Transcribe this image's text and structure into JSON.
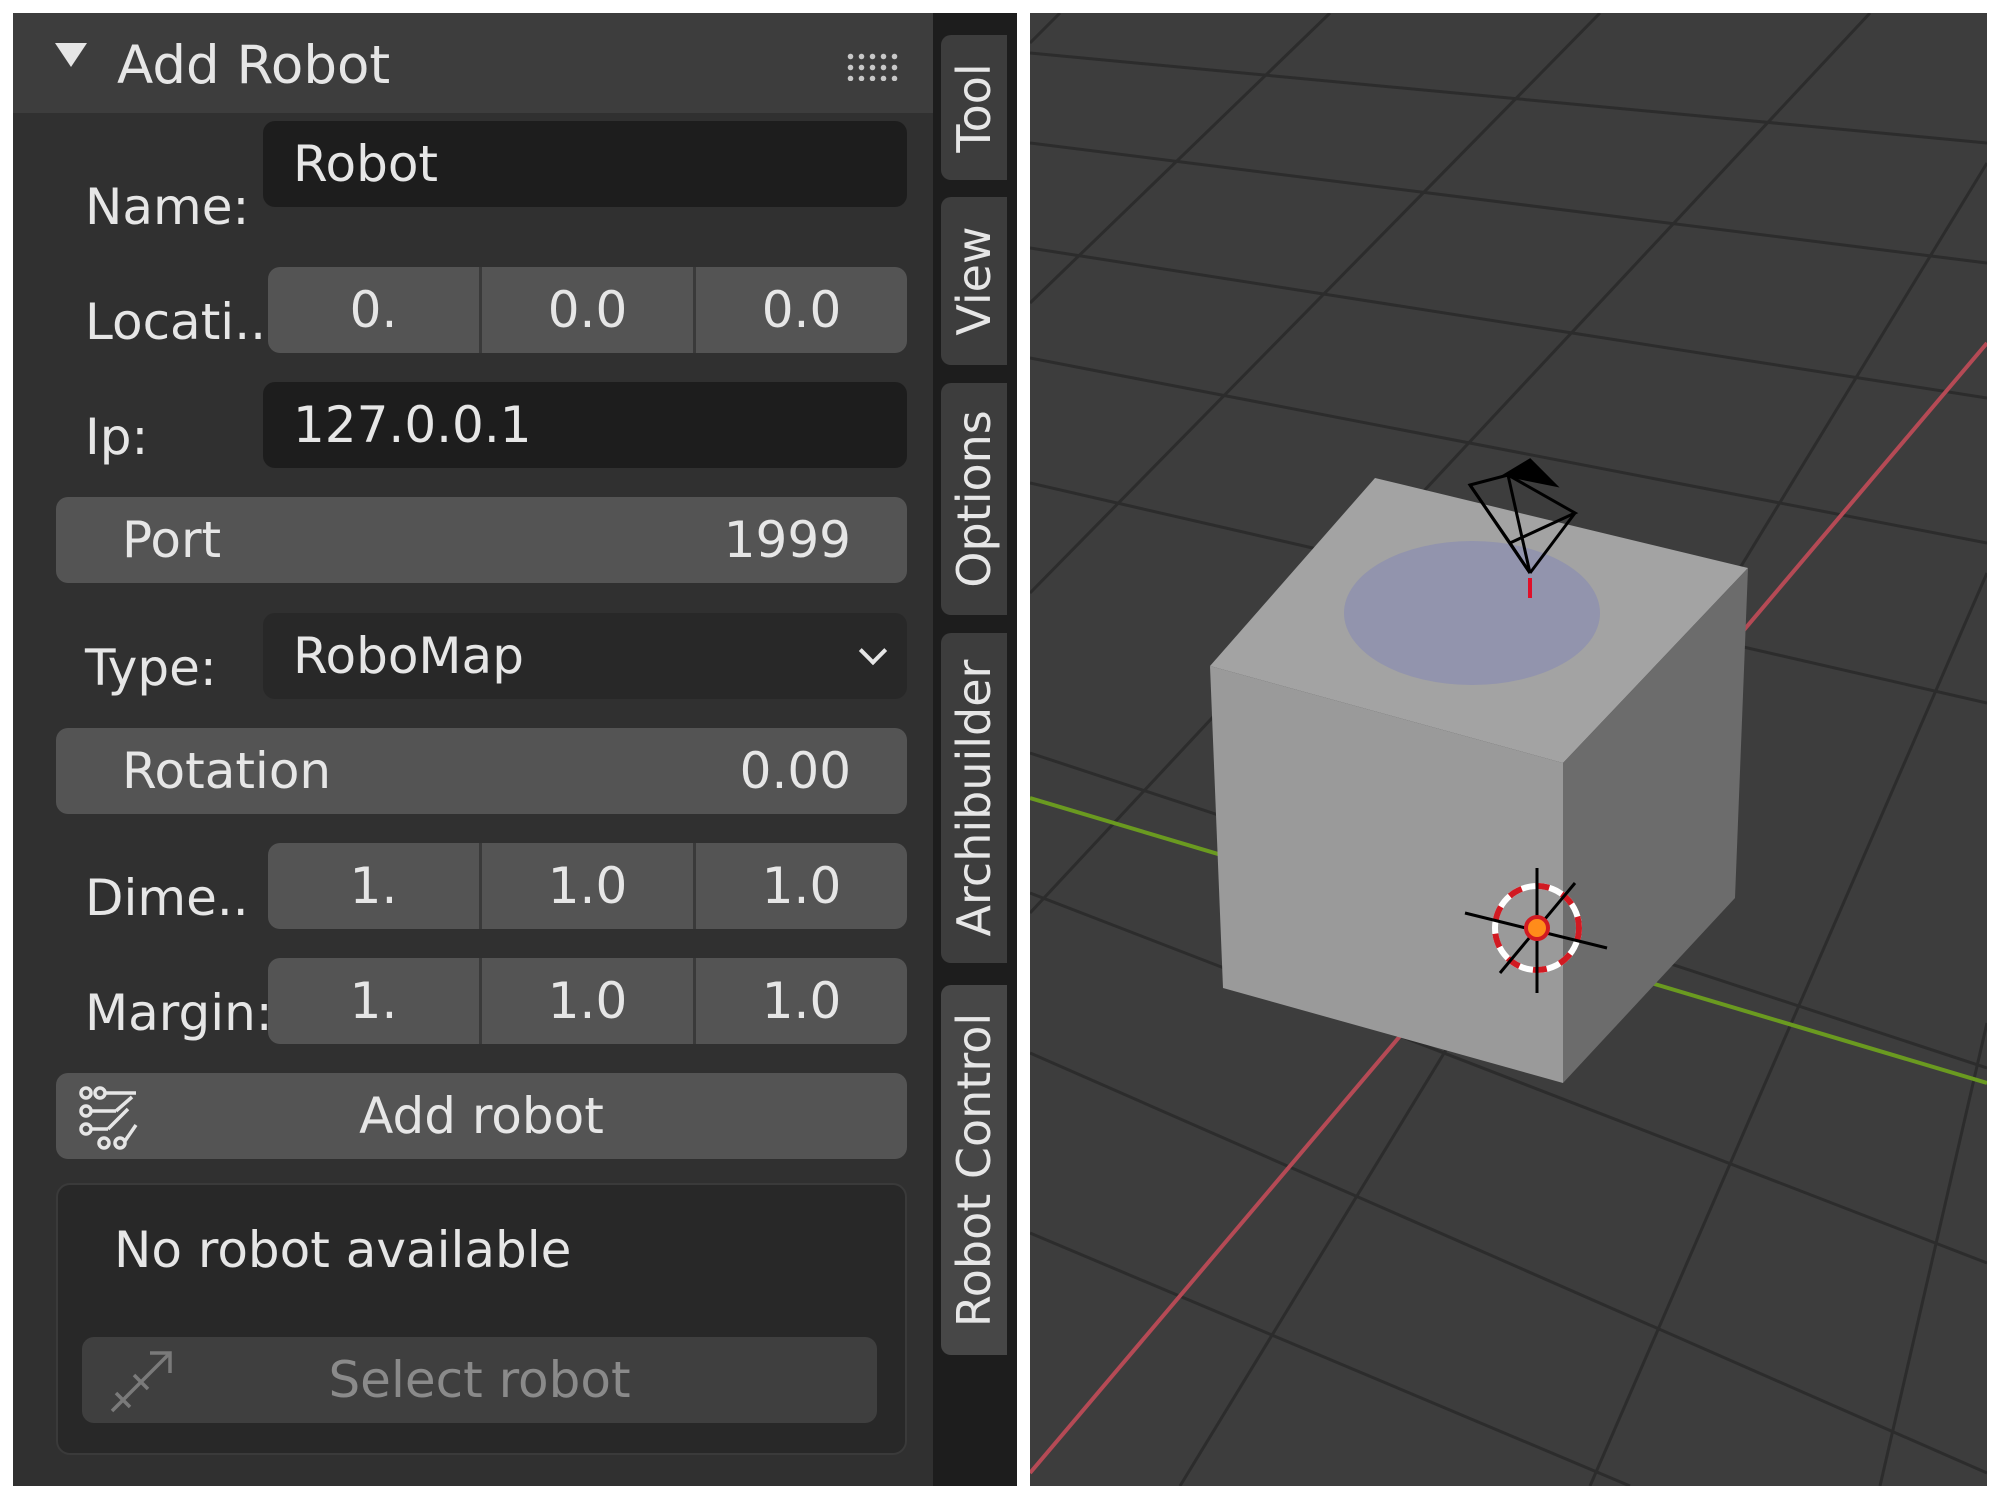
{
  "panel": {
    "title": "Add Robot",
    "name_label": "Name:",
    "name_value": "Robot",
    "location_label": "Locati..",
    "location_values": [
      "0.",
      "0.0",
      "0.0"
    ],
    "ip_label": "Ip:",
    "ip_value": "127.0.0.1",
    "port_label": "Port",
    "port_value": "1999",
    "type_label": "Type:",
    "type_value": "RoboMap",
    "rotation_label": "Rotation",
    "rotation_value": "0.00",
    "dimensions_label": "Dime..",
    "dimensions_values": [
      "1.",
      "1.0",
      "1.0"
    ],
    "margin_label": "Margin:",
    "margin_values": [
      "1.",
      "1.0",
      "1.0"
    ],
    "add_button": "Add robot",
    "status_text": "No robot available",
    "select_button": "Select robot"
  },
  "tabs": [
    "Tool",
    "View",
    "Options",
    "Archibuilder",
    "Robot Control"
  ],
  "active_tab": "Robot Control",
  "icons": {
    "collapse": "triangle-down-icon",
    "drag": "drag-handle-icon",
    "add_robot": "robot-circuit-icon",
    "select_robot": "arrow-pick-icon",
    "type_dropdown": "chevron-down-icon"
  },
  "viewport": {
    "background": "#3d3d3d",
    "grid_color": "#2e2e2e",
    "x_axis_color": "#b54a55",
    "y_axis_color": "#6a9a20",
    "cube_color": "#9e9e9e"
  }
}
